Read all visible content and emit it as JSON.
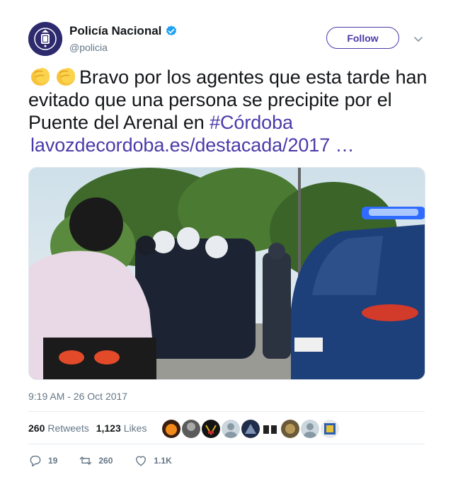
{
  "account": {
    "name": "Policía Nacional",
    "handle": "@policia",
    "follow_label": "Follow"
  },
  "tweet": {
    "text_main": "Bravo por los agentes que esta tarde han evitado que una persona se precipite por el Puente del Arenal en ",
    "hashtag": "#Córdoba",
    "link": "lavozdecordoba.es/destacada/2017 …",
    "timestamp": "9:19 AM - 26 Oct 2017"
  },
  "stats": {
    "retweets_count": "260",
    "retweets_label": "Retweets",
    "likes_count": "1,123",
    "likes_label": "Likes"
  },
  "actions": {
    "reply_count": "19",
    "retweet_count": "260",
    "like_count": "1.1K"
  },
  "colors": {
    "accent": "#4a3aa8",
    "verified": "#1da1f2",
    "muted": "#657786"
  }
}
